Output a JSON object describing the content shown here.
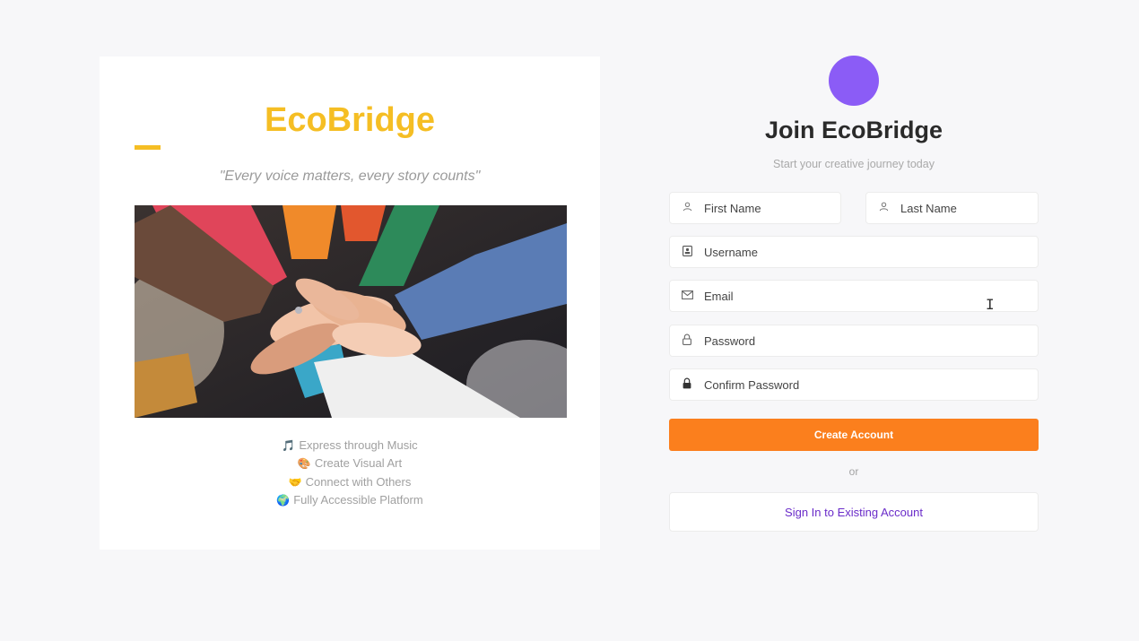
{
  "brand": {
    "name": "EcoBridge",
    "tagline": "\"Every voice matters, every story counts\"",
    "accent_color": "#f5be24"
  },
  "hero_image": {
    "icon": "team-hands-stacked-photo"
  },
  "features": [
    {
      "icon": "music-note-icon",
      "glyph": "🎵",
      "label": "Express through Music"
    },
    {
      "icon": "palette-icon",
      "glyph": "🎨",
      "label": "Create Visual Art"
    },
    {
      "icon": "handshake-icon",
      "glyph": "🤝",
      "label": "Connect with Others"
    },
    {
      "icon": "globe-icon",
      "glyph": "🌍",
      "label": "Fully Accessible Platform"
    }
  ],
  "signup": {
    "avatar_color": "#8b5cf6",
    "title": "Join EcoBridge",
    "subtitle": "Start your creative journey today",
    "fields": {
      "first_name": {
        "placeholder": "First Name",
        "value": "",
        "icon": "user-icon"
      },
      "last_name": {
        "placeholder": "Last Name",
        "value": "",
        "icon": "user-icon"
      },
      "username": {
        "placeholder": "Username",
        "value": "",
        "icon": "id-badge-icon"
      },
      "email": {
        "placeholder": "Email",
        "value": "",
        "icon": "envelope-icon"
      },
      "password": {
        "placeholder": "Password",
        "value": "",
        "icon": "lock-open-icon"
      },
      "confirm_password": {
        "placeholder": "Confirm Password",
        "value": "",
        "icon": "lock-icon"
      }
    },
    "create_label": "Create Account",
    "create_color": "#fb7f1d",
    "or_label": "or",
    "signin_label": "Sign In to Existing Account",
    "signin_color": "#6a2cc9"
  }
}
